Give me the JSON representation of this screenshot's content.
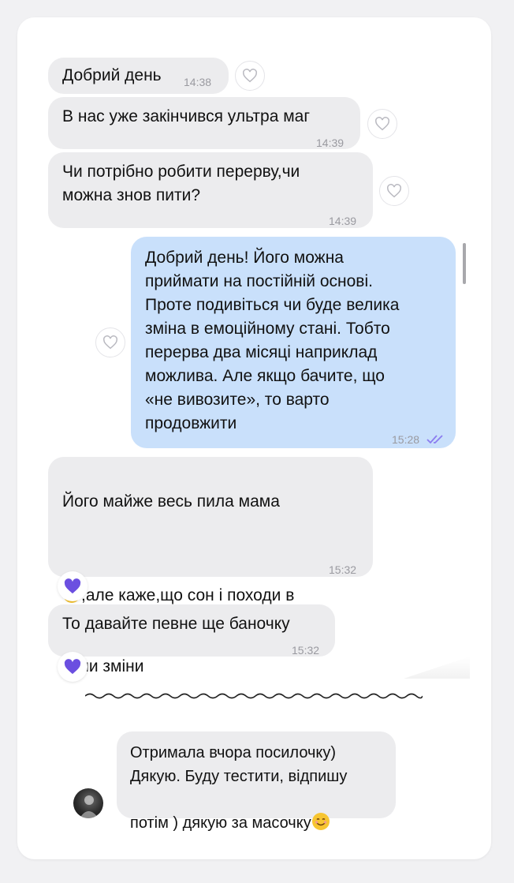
{
  "messages": [
    {
      "text": "Добрий день",
      "time": "14:38"
    },
    {
      "text": "В нас уже закінчився ультра маг",
      "time": "14:39"
    },
    {
      "text": "Чи потрібно робити перерву,чи\nможна знов пити?",
      "time": "14:39"
    },
    {
      "text": "Добрий день! Його можна\nприймати на постійній основі.\nПроте подивіться чи буде велика\nзміна в емоційному стані. Тобто\nперерва два місяці наприклад\nможлива. Але якщо бачите, що\n«не вивозите», то варто\nпродовжити",
      "time": "15:28"
    },
    {
      "line1": "Його майже весь пила мама",
      "line2": ",але каже,що сон і походи в",
      "line3": "туалет налагодились і відчутні\nбули зміни",
      "time": "15:32"
    },
    {
      "text": "То давайте певне ще баночку",
      "time": "15:32"
    }
  ],
  "review": {
    "text": "Отримала вчора посилочку)\nДякую. Буду тестити, відпишу\nпотім ) дякую за масочку"
  },
  "icons": {
    "like": "heart-outline-icon",
    "reaction": "purple-heart-icon",
    "read": "double-check-icon",
    "emoji_sweat": "grinning-sweat-emoji",
    "emoji_smile": "smiling-face-emoji"
  },
  "colors": {
    "incoming_bubble": "#ececee",
    "outgoing_bubble": "#c9e0fb",
    "reaction_heart": "#6b4fe0",
    "read_check": "#8b7cf0"
  }
}
